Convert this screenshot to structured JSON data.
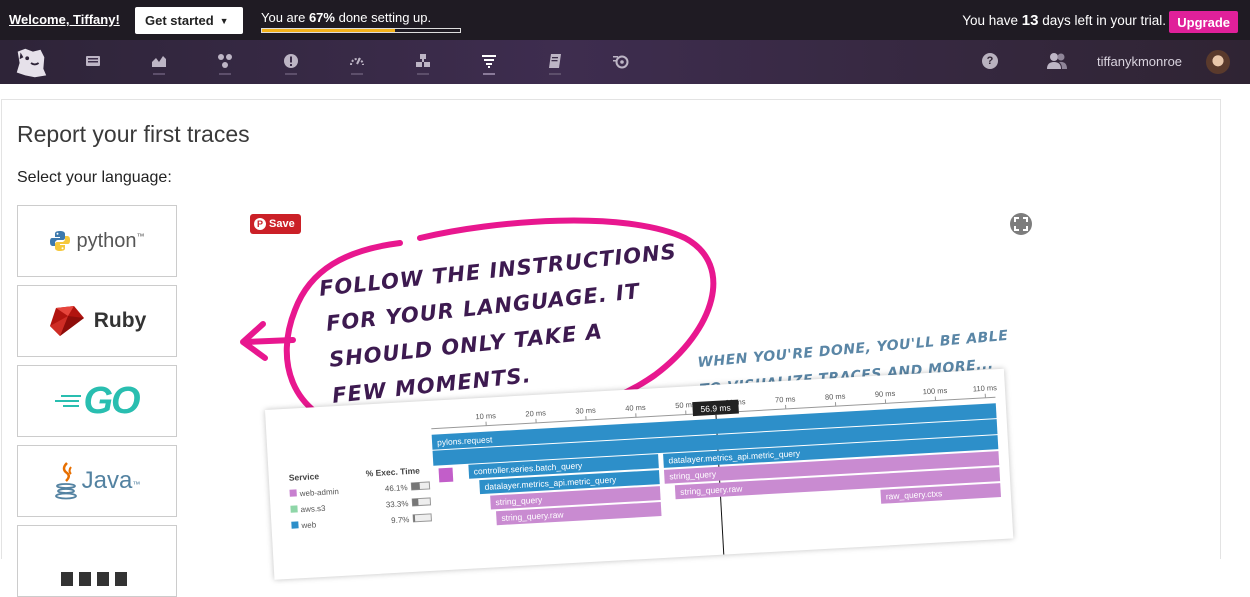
{
  "banner": {
    "welcome": "Welcome, Tiffany!",
    "get_started": "Get started",
    "progress_prefix": "You are ",
    "progress_pct_label": "67%",
    "progress_suffix": " done setting up.",
    "progress_fraction": 0.67,
    "trial_prefix": "You have ",
    "trial_days": "13",
    "trial_suffix": " days left in your trial.",
    "upgrade": "Upgrade",
    "accent_color": "#e0209a",
    "progress_color": "#f2b21a"
  },
  "navbar": {
    "icons": [
      "dashboards-icon",
      "metrics-icon",
      "integrations-icon",
      "monitors-icon",
      "performance-icon",
      "infrastructure-icon",
      "apm-icon",
      "logs-icon",
      "synthetics-icon"
    ],
    "help_icon_glyph": "?",
    "username": "tiffanykmonroe"
  },
  "page": {
    "title": "Report your first traces",
    "select_label": "Select your language:",
    "languages": [
      "python",
      "Ruby",
      "GO",
      "Java"
    ],
    "python_tm": "™",
    "java_tm": "™"
  },
  "illustration": {
    "pin_save": "Save",
    "callout_lines": [
      "Follow the instructions",
      "for your language. It",
      "should only take a",
      "few moments."
    ],
    "note_lines": [
      "When you're done, you'll be able",
      "to visualize traces and more..."
    ],
    "callout_color": "#e8178f",
    "note_color": "#5a86a6"
  },
  "trace": {
    "cursor_label": "56.9 ms",
    "ticks": [
      "10 ms",
      "20 ms",
      "30 ms",
      "40 ms",
      "50 ms",
      "60 ms",
      "70 ms",
      "80 ms",
      "90 ms",
      "100 ms",
      "110 ms"
    ],
    "service_header": "Service",
    "exec_header": "% Exec. Time",
    "services": [
      {
        "name": "web-admin",
        "pct": "46.1%",
        "color": "#c77fcf"
      },
      {
        "name": "aws.s3",
        "pct": "33.3%",
        "color": "#8fd6a8"
      },
      {
        "name": "web",
        "pct": "9.7%",
        "color": "#2d8fc9"
      }
    ],
    "spans": [
      "pylons.request",
      "controller.series.batch_query",
      "datalayer.metrics_api.metric_query",
      "datalayer.metrics_api.metric_query",
      "string_query",
      "string_query",
      "string_query.raw",
      "string_query.raw",
      "raw_query.ctxs"
    ]
  }
}
